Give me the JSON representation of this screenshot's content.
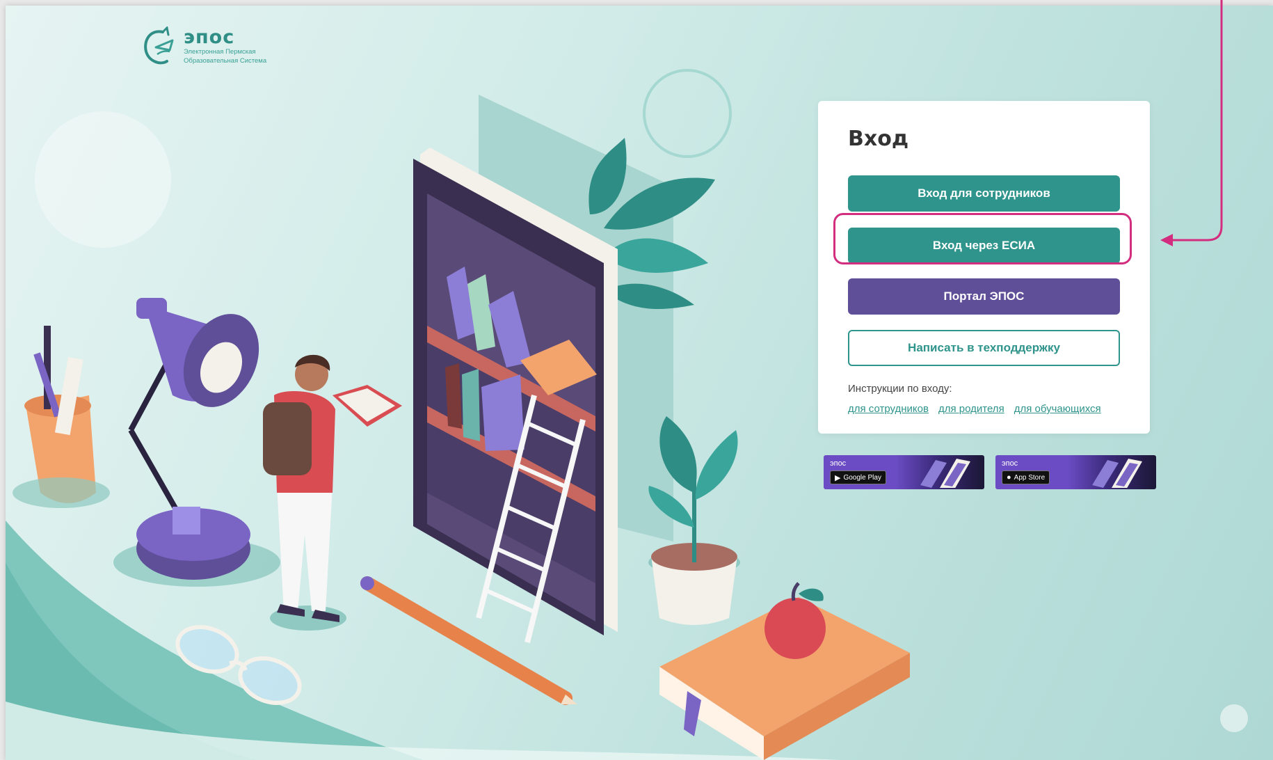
{
  "brand": {
    "name": "эпос",
    "subtitle_line1": "Электронная Пермская",
    "subtitle_line2": "Образовательная Система"
  },
  "login": {
    "title": "Вход",
    "buttons": {
      "staff": "Вход для сотрудников",
      "esia": "Вход через ЕСИА",
      "portal": "Портал ЭПОС",
      "support": "Написать в техподдержку"
    },
    "instructions_label": "Инструкции по входу:",
    "instruction_links": [
      "для сотрудников",
      "для родителя",
      "для обучающихся"
    ]
  },
  "app_badges": {
    "google_play": {
      "brand": "эпос",
      "store": "Google Play"
    },
    "app_store": {
      "brand": "эпос",
      "store": "App Store"
    }
  },
  "colors": {
    "teal": "#2f948b",
    "purple": "#5f4f98",
    "highlight": "#d32d7f"
  },
  "icons": [
    "logo-icon",
    "google-play-icon",
    "apple-icon"
  ]
}
